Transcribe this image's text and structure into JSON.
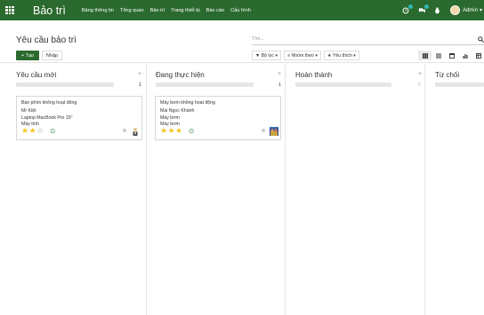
{
  "topbar": {
    "app_name": "Bảo trì",
    "menu": [
      "Bảng thông tin",
      "Tổng quan",
      "Bảo trì",
      "Trang thiết bị",
      "Báo cáo",
      "Cấu hình"
    ],
    "user": "Admin",
    "user_caret": "▾"
  },
  "control": {
    "breadcrumb": "Yêu cầu bảo trì",
    "search_placeholder": "Tìm...",
    "create_label": "+ Tạo",
    "import_label": "Nhập",
    "filters": [
      "▼ Bộ lọc ▾",
      "≡ Nhóm theo ▾",
      "★ Yêu thích ▾"
    ],
    "search_glyph": "🔍"
  },
  "columns": [
    {
      "title": "Yêu cầu mới",
      "count": "1"
    },
    {
      "title": "Đang thực hiện",
      "count": "1"
    },
    {
      "title": "Hoàn thành",
      "count": "0"
    },
    {
      "title": "Từ chối",
      "count": ""
    }
  ],
  "cards": [
    {
      "title": "Bàn phím không hoạt động",
      "lines": [
        "Mr Kiệt",
        "Laptop MacBook Pro 15\"",
        "Máy tính"
      ],
      "stars_on": 2,
      "stars_total": 3
    },
    {
      "title": "Máy bơm không hoạt động",
      "lines": [
        "Mai Ngọc Khánh",
        "Máy bơm",
        "Máy bơm"
      ],
      "stars_on": 3,
      "stars_total": 3
    }
  ],
  "colors": {
    "topbar": "#2b6a2e",
    "star": "#f3c623",
    "activity": "#2e8540"
  }
}
